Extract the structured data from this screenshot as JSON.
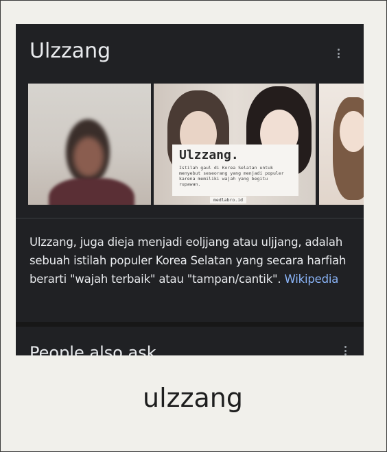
{
  "knowledge_panel": {
    "title": "Ulzzang",
    "more_options_icon": "vertical-dots-icon",
    "image_card": {
      "headline": "Ulzzang.",
      "text": "Istilah gaul di Korea Selatan untuk menyebut seseorang yang menjadi populer karena memiliki wajah yang begitu rupawan.",
      "source": "medlabro.id"
    },
    "description": "Ulzzang, juga dieja menjadi eoljjang atau uljjang, adalah sebuah istilah populer Korea Selatan yang secara harfiah berarti \"wajah terbaik\" atau \"tampan/cantik\".",
    "source_link": "Wikipedia"
  },
  "people_also_ask": {
    "title": "People also ask"
  },
  "caption": "ulzzang"
}
